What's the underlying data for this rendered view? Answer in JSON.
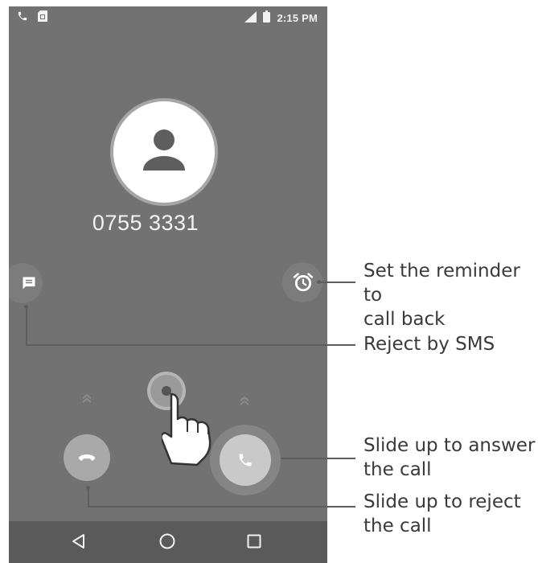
{
  "status_bar": {
    "time": "2:15 PM",
    "left_icons": [
      "call-icon",
      "sim-icon"
    ],
    "right_icons": [
      "signal-icon",
      "battery-icon"
    ]
  },
  "call": {
    "number": "0755 3331"
  },
  "navigation": {
    "items": [
      "back-icon",
      "home-icon",
      "recents-icon"
    ]
  },
  "callouts": {
    "reminder": [
      "Set the reminder to",
      "call back"
    ],
    "sms": "Reject by SMS",
    "answer": [
      "Slide up to answer",
      "the call"
    ],
    "reject": [
      "Slide up to reject",
      "the call"
    ]
  },
  "colors": {
    "screen_bg": "#727272",
    "navbar_bg": "#5a5a5a",
    "callout_text": "#3a3a3a"
  }
}
